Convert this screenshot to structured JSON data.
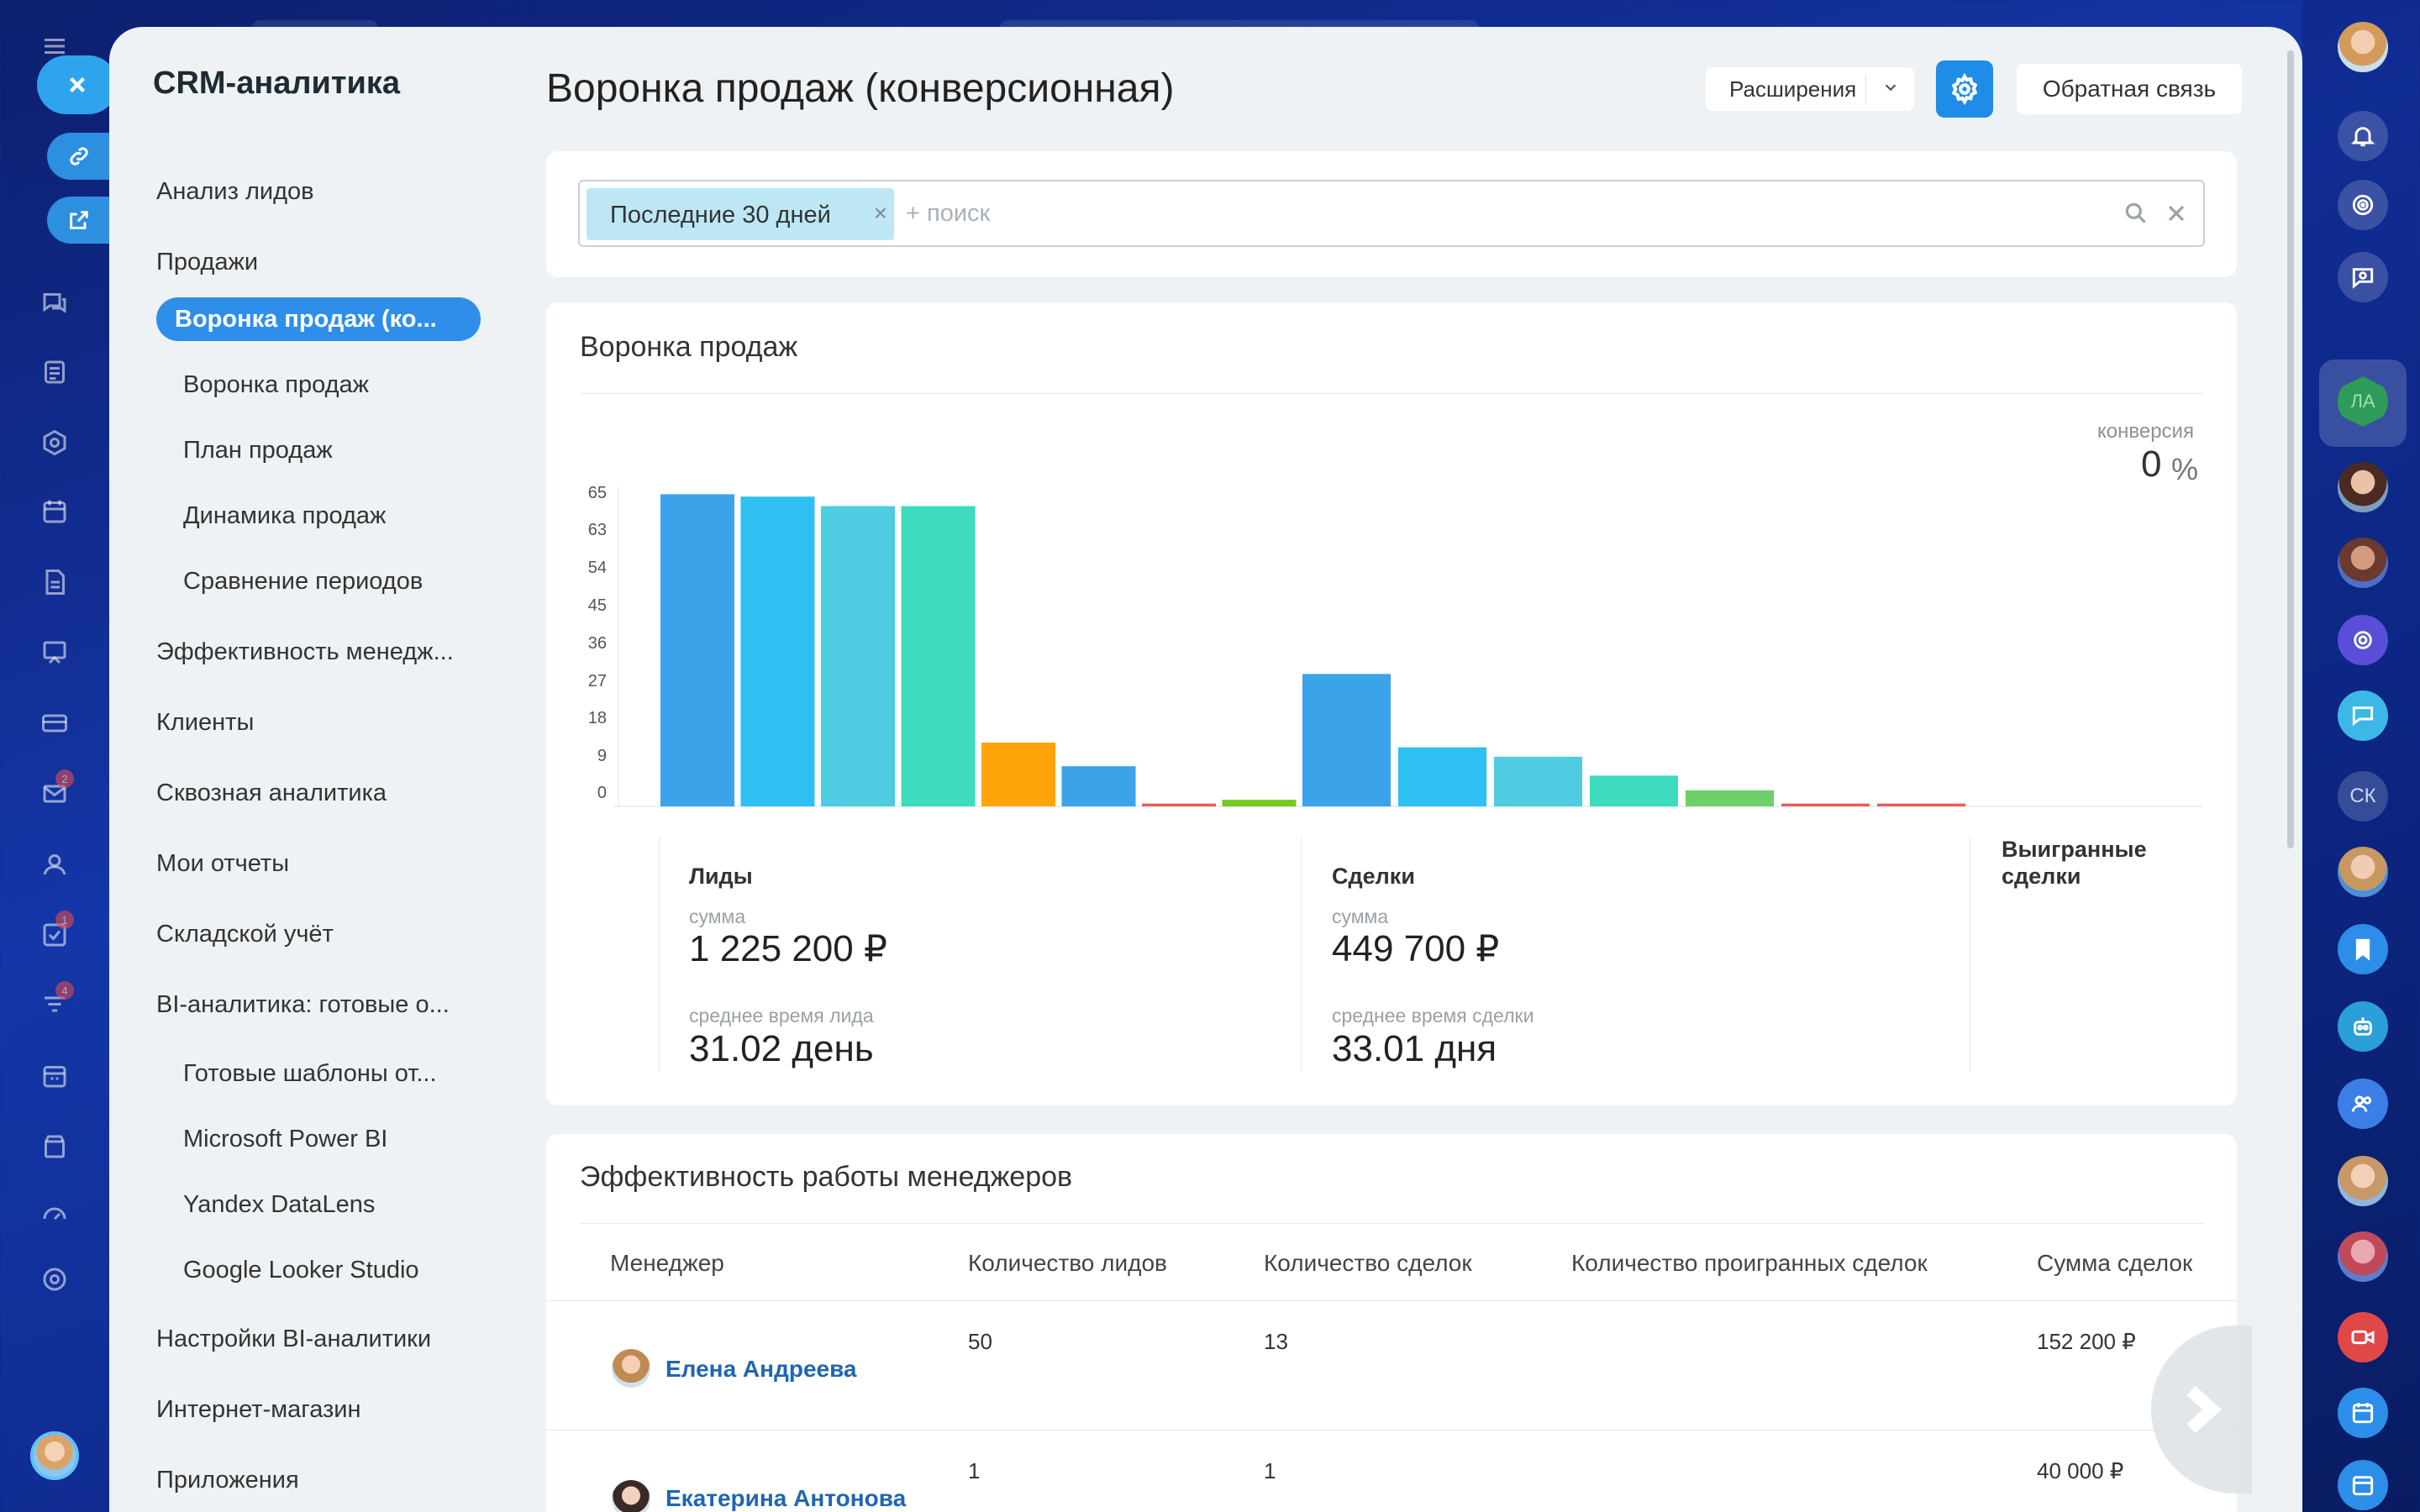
{
  "sidebar": {
    "title": "CRM-аналитика",
    "items": [
      {
        "label": "Анализ лидов",
        "level": 0
      },
      {
        "label": "Продажи",
        "level": 0
      },
      {
        "label": "Воронка продаж (ко...",
        "level": 0,
        "active": true
      },
      {
        "label": "Воронка продаж",
        "level": 1
      },
      {
        "label": "План продаж",
        "level": 1
      },
      {
        "label": "Динамика продаж",
        "level": 1
      },
      {
        "label": "Сравнение периодов",
        "level": 1
      },
      {
        "label": "Эффективность менедж...",
        "level": 0
      },
      {
        "label": "Клиенты",
        "level": 0
      },
      {
        "label": "Сквозная аналитика",
        "level": 0
      },
      {
        "label": "Мои отчеты",
        "level": 0
      },
      {
        "label": "Складской учёт",
        "level": 0
      },
      {
        "label": "BI-аналитика: готовые о...",
        "level": 0
      },
      {
        "label": "Готовые шаблоны от...",
        "level": 1
      },
      {
        "label": "Microsoft Power BI",
        "level": 1
      },
      {
        "label": "Yandex DataLens",
        "level": 1
      },
      {
        "label": "Google Looker Studio",
        "level": 1
      },
      {
        "label": "Настройки BI-аналитики",
        "level": 0
      },
      {
        "label": "Интернет-магазин",
        "level": 0
      },
      {
        "label": "Приложения",
        "level": 0
      }
    ]
  },
  "header": {
    "title": "Воронка продаж (конверсионная)",
    "extensions_label": "Расширения",
    "feedback_label": "Обратная связь"
  },
  "filter": {
    "chip_label": "Последние 30 дней",
    "chip_close": "×",
    "placeholder": "+ поиск"
  },
  "left_rail": {
    "badges": [
      "2",
      "1",
      "4"
    ]
  },
  "right_rail": {
    "initials": [
      "ЛА",
      "СК"
    ]
  },
  "funnel": {
    "title": "Воронка продаж",
    "conversion_label": "конверсия",
    "conversion_value": "0",
    "conversion_unit": "%",
    "chart_data": {
      "type": "bar",
      "yticks": [
        0,
        9,
        18,
        27,
        36,
        45,
        54,
        63,
        65
      ],
      "ylim": [
        0,
        65
      ],
      "leads_bars": [
        {
          "value": 66,
          "color": "#3ba3ea"
        },
        {
          "value": 65.5,
          "color": "#2ec0f2"
        },
        {
          "value": 63.5,
          "color": "#4fcbe2"
        },
        {
          "value": 63.5,
          "color": "#3ddcbe"
        },
        {
          "value": 13.5,
          "color": "#ffa40a"
        },
        {
          "value": 8.5,
          "color": "#3ba3ea"
        },
        {
          "value": 0.6,
          "color": "#ec5a5a"
        },
        {
          "value": 1.4,
          "color": "#78c920"
        }
      ],
      "deals_bars": [
        {
          "value": 28,
          "color": "#3ba3ea"
        },
        {
          "value": 12.5,
          "color": "#2ec0f2"
        },
        {
          "value": 10.5,
          "color": "#4fcbe2"
        },
        {
          "value": 6.5,
          "color": "#3ddcbe"
        },
        {
          "value": 3.4,
          "color": "#6ed06a"
        },
        {
          "value": 0.6,
          "color": "#ec5a5a"
        },
        {
          "value": 0.6,
          "color": "#ec5a5a"
        }
      ]
    },
    "stats": {
      "leads": {
        "title": "Лиды",
        "sum_label": "сумма",
        "sum": "1 225 200 ₽",
        "avg_label": "среднее время лида",
        "avg": "31.02 день"
      },
      "deals": {
        "title": "Сделки",
        "sum_label": "сумма",
        "sum": "449 700 ₽",
        "avg_label": "среднее время сделки",
        "avg": "33.01 дня"
      },
      "won": {
        "title_line1": "Выигранные",
        "title_line2": "сделки"
      }
    }
  },
  "managers": {
    "title": "Эффективность работы менеджеров",
    "columns": [
      "Менеджер",
      "Количество лидов",
      "Количество сделок",
      "Количество проигранных сделок",
      "Сумма сделок"
    ],
    "rows": [
      {
        "name": "Елена Андреева",
        "leads": "50",
        "deals": "13",
        "lost": "",
        "sum": "152 200 ₽"
      },
      {
        "name": "Екатерина Антонова",
        "leads": "1",
        "deals": "1",
        "lost": "",
        "sum": "40 000 ₽"
      }
    ]
  },
  "colors": {
    "accent": "#2f8eea",
    "panel_bg": "#eef2f4",
    "link": "#2066b0"
  }
}
